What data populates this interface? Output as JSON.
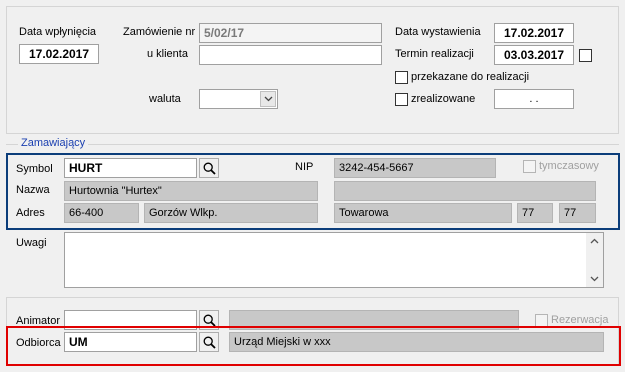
{
  "order": {
    "received_date_label": "Data wpłynięcia",
    "received_date": "17.02.2017",
    "order_no_label": "Zamówienie nr",
    "order_no": "5/02/17",
    "client_label": "u klienta",
    "client_order_no": "",
    "currency_label": "waluta",
    "currency_value": "",
    "issue_date_label": "Data wystawienia",
    "issue_date": "17.02.2017",
    "deadline_label": "Termin realizacji",
    "deadline": "03.03.2017",
    "forwarded_label": "przekazane do realizacji",
    "completed_label": "zrealizowane",
    "completed_date": ". ."
  },
  "customer": {
    "group_label": "Zamawiający",
    "symbol_label": "Symbol",
    "symbol": "HURT",
    "nip_label": "NIP",
    "nip": "3242-454-5667",
    "temporary_label": "tymczasowy",
    "name_label": "Nazwa",
    "name": "Hurtownia \"Hurtex\"",
    "name2": "",
    "address_label": "Adres",
    "postal_code": "66-400",
    "city": "Gorzów Wlkp.",
    "street": "Towarowa",
    "house_no": "77",
    "flat_no": "77"
  },
  "notes": {
    "label": "Uwagi",
    "value": ""
  },
  "bottom": {
    "animator_label": "Animator",
    "animator_code": "",
    "animator_name": "",
    "reservation_label": "Rezerwacja",
    "recipient_label": "Odbiorca",
    "recipient_code": "UM",
    "recipient_name": "Urząd Miejski w xxx"
  },
  "colors": {
    "customer_highlight": "#0b3d7a",
    "recipient_highlight": "#e00000",
    "group_title": "#1a3fb0"
  }
}
